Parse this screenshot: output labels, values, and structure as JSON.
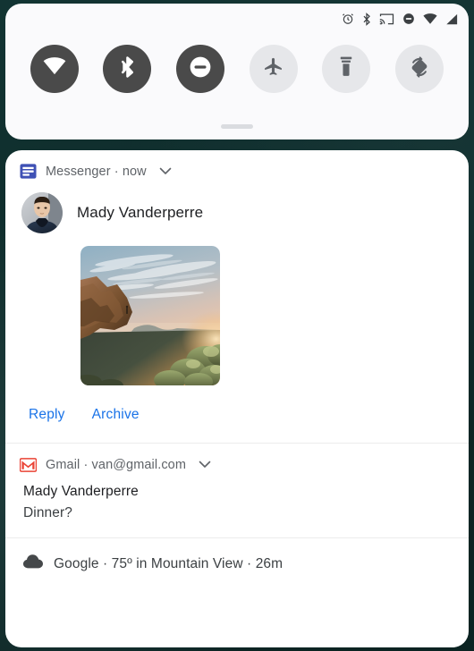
{
  "status_bar": {
    "icons": [
      "alarm-icon",
      "bluetooth-icon",
      "cast-icon",
      "do-not-disturb-icon",
      "wifi-icon",
      "signal-icon"
    ]
  },
  "quick_settings": {
    "tiles": [
      {
        "name": "wifi",
        "icon": "wifi-icon",
        "state": "on"
      },
      {
        "name": "bluetooth",
        "icon": "bluetooth-icon",
        "state": "on"
      },
      {
        "name": "dnd",
        "icon": "do-not-disturb-icon",
        "state": "on"
      },
      {
        "name": "airplane",
        "icon": "airplane-icon",
        "state": "off"
      },
      {
        "name": "flashlight",
        "icon": "flashlight-icon",
        "state": "off"
      },
      {
        "name": "auto-rotate",
        "icon": "auto-rotate-icon",
        "state": "off"
      }
    ],
    "handle": "drag-handle"
  },
  "notifications": [
    {
      "id": "messenger",
      "app": "Messenger",
      "separator": "·",
      "time": "now",
      "header_text": "Messenger · now",
      "sender": "Mady Vanderperre",
      "attachment": "sunset cliff landscape photo",
      "actions": [
        {
          "label": "Reply"
        },
        {
          "label": "Archive"
        }
      ]
    },
    {
      "id": "gmail",
      "app": "Gmail",
      "separator": "·",
      "account": "van@gmail.com",
      "header_text": "Gmail · van@gmail.com",
      "title": "Mady Vanderperre",
      "body": "Dinner?"
    },
    {
      "id": "google",
      "app": "Google",
      "header_text": "Google · 75º in Mountain View · 26m",
      "temperature": "75º",
      "location": "Mountain View",
      "time": "26m"
    }
  ],
  "colors": {
    "accent_blue": "#1a73e8",
    "tile_on": "#4a4a4a",
    "tile_off": "#e6e7ea",
    "gmail_red": "#ea4335",
    "messenger_blue": "#3f51b5",
    "background": "#11302f",
    "card": "#ffffff",
    "panel": "#fafafc"
  }
}
